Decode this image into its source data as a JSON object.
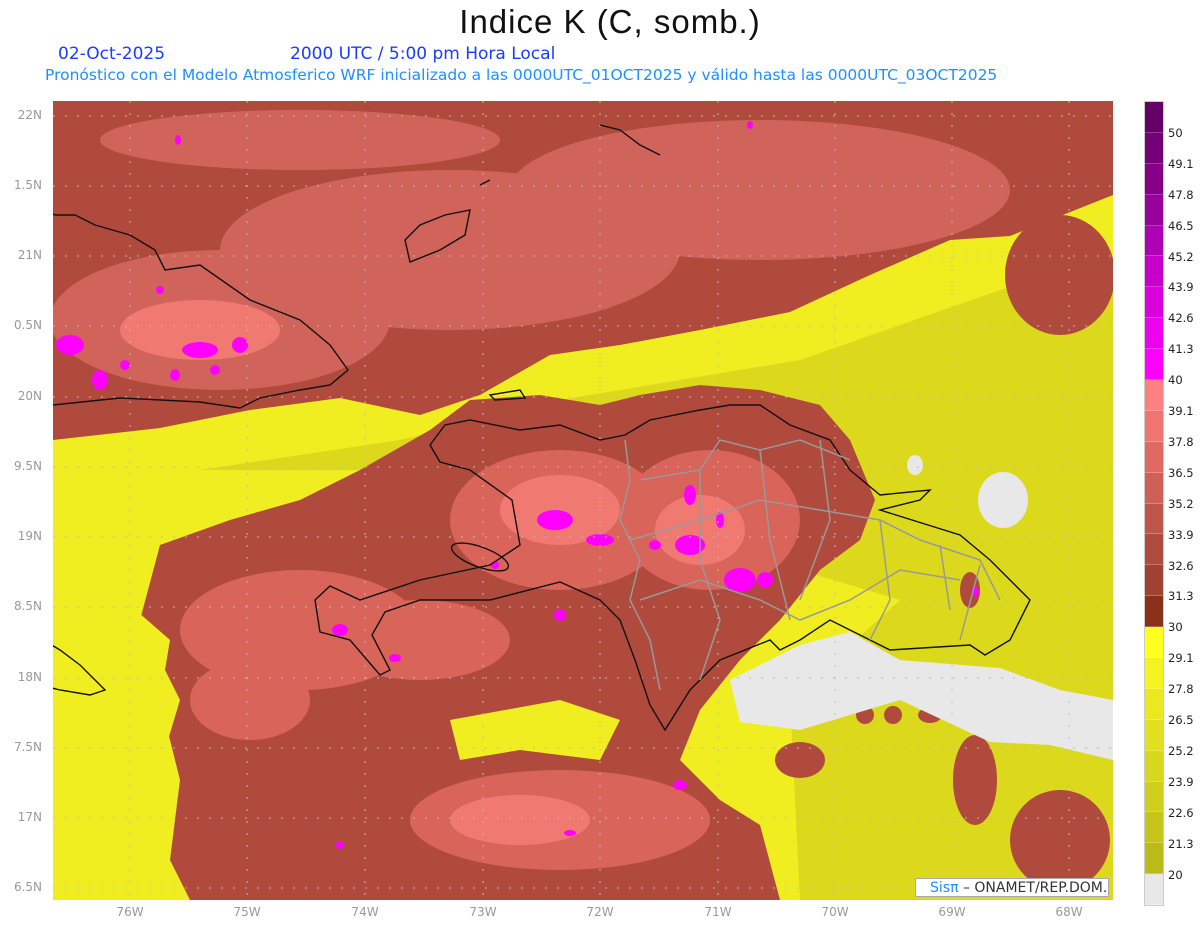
{
  "header": {
    "title": "Indice K (C, somb.)",
    "date": "02-Oct-2025",
    "time": "2000 UTC / 5:00 pm Hora Local",
    "description": "Pronóstico con el Modelo Atmosferico WRF inicializado a las 0000UTC_01OCT2025 y válido hasta las  0000UTC_03OCT2025"
  },
  "map": {
    "lat_labels": [
      "22N",
      "1.5N",
      "21N",
      "0.5N",
      "20N",
      "9.5N",
      "19N",
      "8.5N",
      "18N",
      "7.5N",
      "17N",
      "6.5N"
    ],
    "lon_labels": [
      "76W",
      "75W",
      "74W",
      "73W",
      "72W",
      "71W",
      "70W",
      "69W",
      "68W"
    ],
    "colors": {
      "below": "#e8e8e8",
      "yellow": "#f4f020",
      "dark_red": "#8a3018",
      "mid_red": "#b04a3c",
      "light_red": "#d8645a",
      "pink": "#f07a72",
      "magenta": "#ff00ff"
    }
  },
  "colorbar": {
    "labels": [
      "50",
      "49.1",
      "47.8",
      "46.5",
      "45.2",
      "43.9",
      "42.6",
      "41.3",
      "40",
      "39.1",
      "37.8",
      "36.5",
      "35.2",
      "33.9",
      "32.6",
      "31.3",
      "30",
      "29.1",
      "27.8",
      "26.5",
      "25.2",
      "23.9",
      "22.6",
      "21.3",
      "20"
    ],
    "colors": [
      "#640066",
      "#740078",
      "#860088",
      "#98009c",
      "#ae00b4",
      "#c600ca",
      "#da00dc",
      "#ec00ee",
      "#ff00ff",
      "#ff8080",
      "#f07570",
      "#e06a62",
      "#d06056",
      "#c0564a",
      "#b04c3e",
      "#a04232",
      "#8a3018",
      "#ffff1e",
      "#f5f31e",
      "#ebe91e",
      "#e2e01e",
      "#d9d71c",
      "#d0ce1a",
      "#c6c418",
      "#bcba18",
      "#e8e8e8"
    ]
  },
  "credit": {
    "brand": "Sisπ",
    "text": " –  ONAMET/REP.DOM."
  }
}
